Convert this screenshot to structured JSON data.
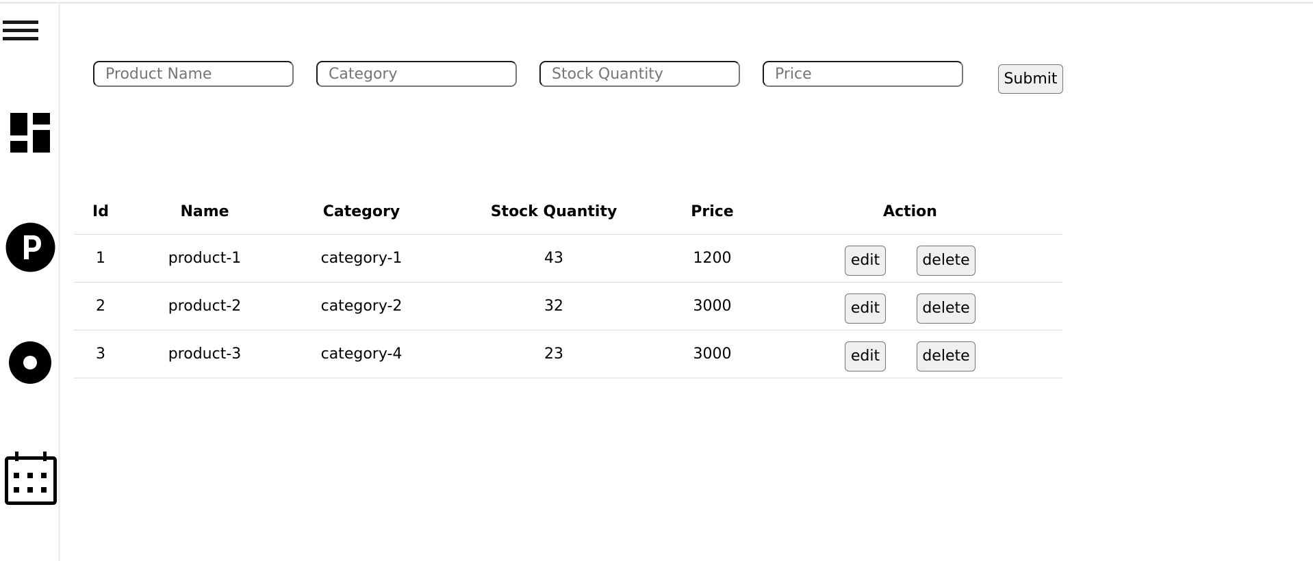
{
  "sidebar": {
    "icons": [
      "hamburger-menu-icon",
      "dashboard-icon",
      "parking-icon",
      "radio-button-icon",
      "calendar-icon"
    ]
  },
  "form": {
    "product_name_placeholder": "Product Name",
    "category_placeholder": "Category",
    "stock_quantity_placeholder": "Stock Quantity",
    "price_placeholder": "Price",
    "product_name_value": "",
    "category_value": "",
    "stock_quantity_value": "",
    "price_value": "",
    "submit_label": "Submit"
  },
  "table": {
    "headers": {
      "id": "Id",
      "name": "Name",
      "category": "Category",
      "stock": "Stock Quantity",
      "price": "Price",
      "action": "Action"
    },
    "rows": [
      {
        "id": "1",
        "name": "product-1",
        "category": "category-1",
        "stock": "43",
        "price": "1200",
        "edit": "edit",
        "delete": "delete"
      },
      {
        "id": "2",
        "name": "product-2",
        "category": "category-2",
        "stock": "32",
        "price": "3000",
        "edit": "edit",
        "delete": "delete"
      },
      {
        "id": "3",
        "name": "product-3",
        "category": "category-4",
        "stock": "23",
        "price": "3000",
        "edit": "edit",
        "delete": "delete"
      }
    ]
  }
}
